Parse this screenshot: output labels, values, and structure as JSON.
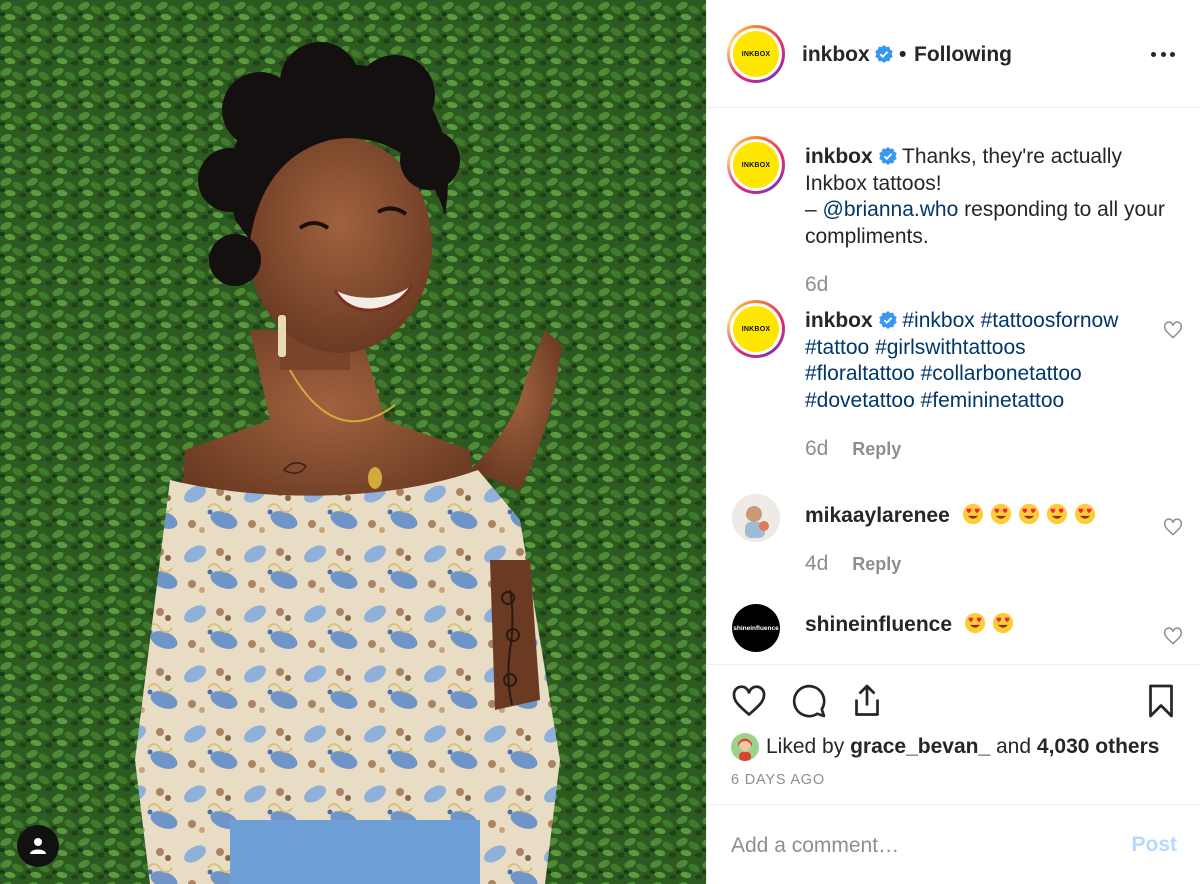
{
  "post": {
    "author": "inkbox",
    "brand_logo_text": "INKBOX",
    "follow_status": "Following",
    "separator": "•",
    "accent_color": "#3897f0",
    "verified": true
  },
  "comments": [
    {
      "username": "inkbox",
      "text_line1": "Thanks, they're actually",
      "text_line2": "Inkbox tattoos!",
      "text_dash": "– ",
      "mention": "@brianna.who",
      "text_tail": " responding to all your compliments.",
      "time": "6d"
    },
    {
      "username": "inkbox",
      "hashtags": [
        "#inkbox",
        "#tattoosfornow",
        "#tattoo",
        "#girlswithtattoos",
        "#floraltattoo",
        "#collarbonetattoo",
        "#dovetattoo",
        "#femininetattoo"
      ],
      "time": "6d",
      "reply_label": "Reply"
    },
    {
      "username": "mikaaylarenee",
      "emoji": "heart-eyes",
      "emoji_count": 5,
      "time": "4d",
      "reply_label": "Reply"
    },
    {
      "username": "shineinfluence",
      "avatar_text": "shineinfluence",
      "emoji": "heart-eyes",
      "emoji_count": 2
    }
  ],
  "actions": {
    "liked_by_prefix": "Liked by",
    "liked_by_user": "grace_bevan_",
    "and_label": "and",
    "others_label": "4,030 others",
    "posted_ago": "6 DAYS AGO"
  },
  "add_comment": {
    "placeholder": "Add a comment…",
    "post_label": "Post"
  },
  "icons": {
    "verified": "verified-badge-icon",
    "more": "more-options-icon",
    "like": "heart-icon",
    "comment": "comment-icon",
    "share": "share-icon",
    "save": "bookmark-icon",
    "user_tags": "user-icon"
  }
}
